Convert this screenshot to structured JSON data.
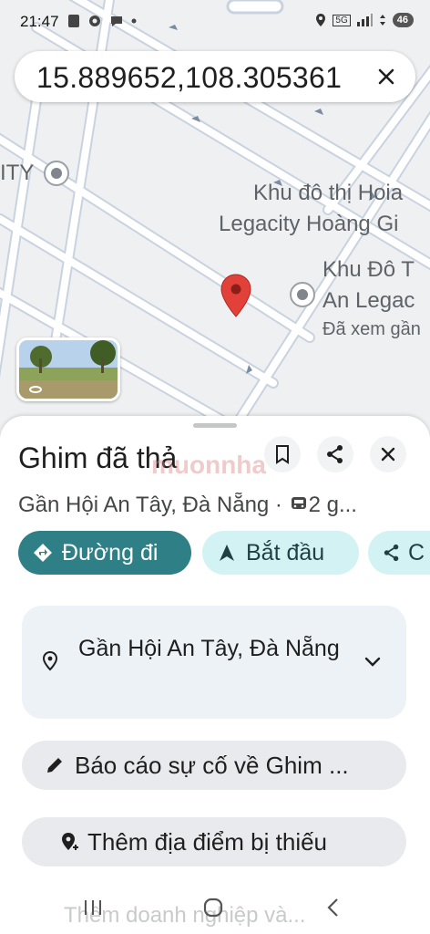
{
  "status_bar": {
    "time": "21:47",
    "network": "5G",
    "battery": "46"
  },
  "search": {
    "query": "15.889652,108.305361"
  },
  "map": {
    "labels": {
      "left_cut": "ITY",
      "poi1_line1": "Khu đô thị Hoia",
      "poi1_line2": "Legacity Hoàng Gi",
      "poi2_line1": "Khu Đô T",
      "poi2_line2": "An Legac",
      "poi2_line3": "Đã xem gần"
    },
    "pin_color": "#e2413a"
  },
  "place": {
    "title": "Ghim đã thả",
    "subtitle": "Gần Hội An Tây, Đà Nẵng · ",
    "subtitle_transit": "2 g...",
    "actions": {
      "directions": "Đường đi",
      "start": "Bắt đầu",
      "share": "C"
    },
    "address": "Gần Hội An Tây, Đà Nẵng",
    "report": "Báo cáo sự cố về Ghim ...",
    "add_missing": "Thêm địa điểm bị thiếu",
    "add_business": "Thêm doanh nghiệp và..."
  },
  "watermark": "muonnha",
  "colors": {
    "primary_chip": "#2f7f86",
    "secondary_chip": "#d3f2f4",
    "pin": "#e2413a"
  }
}
